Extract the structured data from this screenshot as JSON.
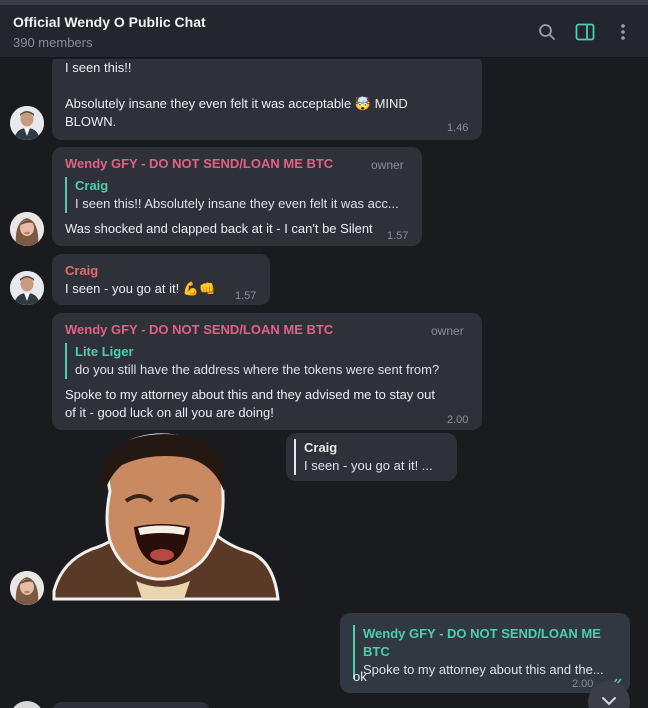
{
  "header": {
    "title": "Official Wendy O Public Chat",
    "members": "390 members",
    "icons": [
      "search-icon",
      "sidebar-toggle-icon",
      "more-icon"
    ],
    "accent": "#4dd0a7"
  },
  "messages": {
    "m1": {
      "line1": "I seen this!!",
      "line2": "Absolutely insane they even felt it was acceptable 🤯 MIND",
      "line3": "BLOWN.",
      "time": "1.46"
    },
    "m2": {
      "sender": "Wendy GFY - DO NOT SEND/LOAN ME BTC",
      "badge": "owner",
      "quote_name": "Craig",
      "quote_text": "I seen this!!  Absolutely insane they even felt it was acc...",
      "text": "Was shocked and clapped back at it - I can't be Silent",
      "time": "1.57"
    },
    "m3": {
      "sender": "Craig",
      "text": "I seen - you go at it! 💪👊",
      "time": "1.57"
    },
    "m4": {
      "sender": "Wendy GFY - DO NOT SEND/LOAN ME BTC",
      "badge": "owner",
      "quote_name": "Lite Liger",
      "quote_text": "do you still have the address where the tokens were sent from?",
      "line1": "Spoke to my attorney about this and they advised me to stay out",
      "line2": "of it - good luck on all you are doing!",
      "time": "2.00"
    },
    "m5": {
      "quote_name": "Craig",
      "quote_text": "I seen - you go at it! ..."
    },
    "m6": {
      "quote_name": "Wendy GFY - DO NOT SEND/LOAN ME BTC",
      "quote_text": "Spoke to my attorney about this and the...",
      "text": "ok",
      "time": "2.00"
    }
  },
  "colors": {
    "owner_name": "#e26185",
    "craig_name": "#e26d6d",
    "quote_accent": "#4dd0a7",
    "incoming_bubble": "#2e3238",
    "outgoing_bubble": "#303842",
    "background": "#1a1b1f"
  }
}
